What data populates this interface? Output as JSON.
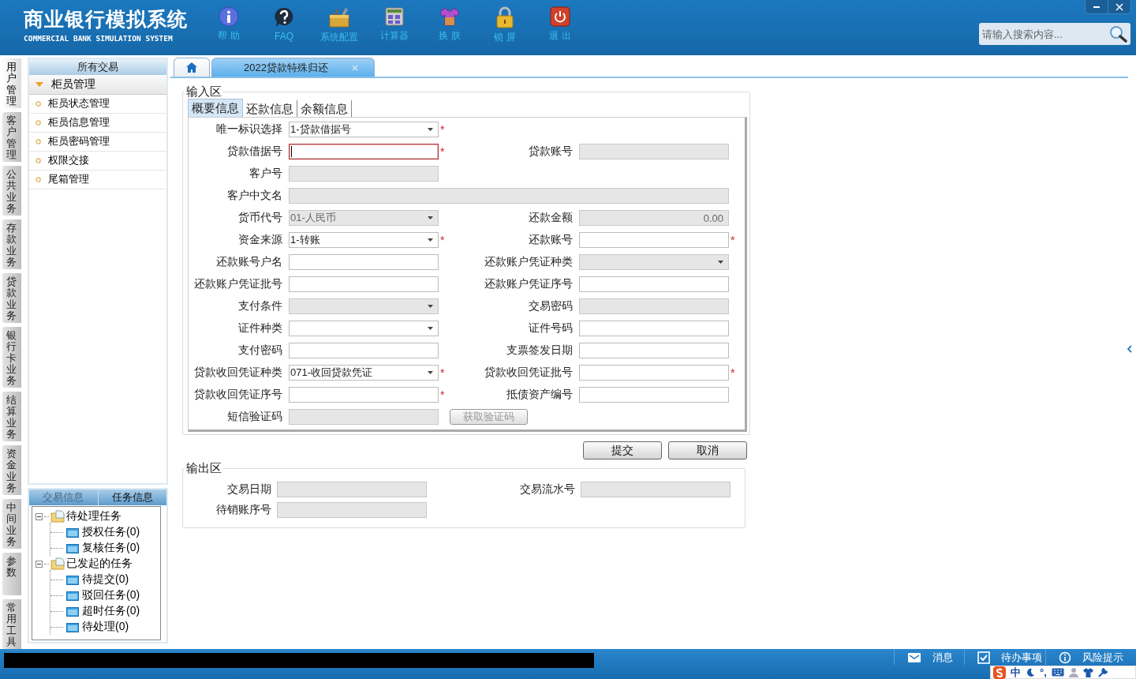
{
  "app": {
    "title": "商业银行模拟系统",
    "subtitle": "COMMERCIAL BANK SIMULATION SYSTEM"
  },
  "toolbar": [
    {
      "kind": "info",
      "label": "帮 助"
    },
    {
      "kind": "faq",
      "label": "FAQ"
    },
    {
      "kind": "config",
      "label": "系统配置"
    },
    {
      "kind": "calculator",
      "label": "计算器"
    },
    {
      "kind": "skin",
      "label": "换 肤"
    },
    {
      "kind": "lock",
      "label": "锁 屏"
    },
    {
      "kind": "exit",
      "label": "退 出"
    }
  ],
  "search": {
    "placeholder": "请输入搜索内容..."
  },
  "module_tabs": [
    {
      "label": "用户管理",
      "selected": true
    },
    {
      "label": "客户管理",
      "selected": false
    },
    {
      "label": "公共业务",
      "selected": false
    },
    {
      "label": "存款业务",
      "selected": false
    },
    {
      "label": "贷款业务",
      "selected": false
    },
    {
      "label": "银行卡业务",
      "selected": false
    },
    {
      "label": "结算业务",
      "selected": false
    },
    {
      "label": "资金业务",
      "selected": false
    },
    {
      "label": "中间业务",
      "selected": false
    },
    {
      "label": "参数",
      "selected": false
    },
    {
      "label": "常用工具",
      "selected": false
    }
  ],
  "nav": {
    "title": "所有交易",
    "groups": [
      {
        "label": "柜员管理",
        "expanded": true,
        "items": [
          "柜员状态管理",
          "柜员信息管理",
          "柜员密码管理",
          "权限交接",
          "尾箱管理"
        ]
      }
    ]
  },
  "task_panel": {
    "tabs": [
      {
        "label": "交易信息",
        "selected": false
      },
      {
        "label": "任务信息",
        "selected": true
      }
    ],
    "tree": [
      {
        "label": "待处理任务",
        "expanded": true,
        "children": [
          {
            "label": "授权任务(0)"
          },
          {
            "label": "复核任务(0)"
          }
        ]
      },
      {
        "label": "已发起的任务",
        "expanded": true,
        "children": [
          {
            "label": "待提交(0)"
          },
          {
            "label": "驳回任务(0)"
          },
          {
            "label": "超时任务(0)"
          },
          {
            "label": "待处理(0)"
          }
        ]
      }
    ]
  },
  "page_tabs": [
    {
      "kind": "home",
      "selected": false,
      "closable": false
    },
    {
      "kind": "page",
      "label": "2022贷款特殊归还",
      "selected": true,
      "closable": true
    }
  ],
  "input_area": {
    "legend": "输入区",
    "required_mark": "*",
    "tabs": [
      {
        "label": "概要信息",
        "selected": true
      },
      {
        "label": "还款信息",
        "selected": false
      },
      {
        "label": "余额信息",
        "selected": false
      }
    ],
    "rows": [
      {
        "left": {
          "label": "唯一标识选择",
          "kind": "select",
          "value": "1-贷款借据号",
          "disabled": false,
          "required": true,
          "invalid": false,
          "wide": false
        }
      },
      {
        "left": {
          "label": "贷款借据号",
          "kind": "text",
          "disabled": false,
          "required": true,
          "invalid": true,
          "wide": false
        },
        "right": {
          "label": "贷款账号",
          "kind": "text",
          "disabled": true,
          "required": false,
          "invalid": false,
          "wide": false
        }
      },
      {
        "left": {
          "label": "客户号",
          "kind": "text",
          "disabled": true,
          "required": false,
          "invalid": false,
          "wide": false
        }
      },
      {
        "left": {
          "label": "客户中文名",
          "kind": "text",
          "disabled": true,
          "required": false,
          "invalid": false,
          "wide": true
        }
      },
      {
        "left": {
          "label": "货币代号",
          "kind": "select",
          "value": "01-人民币",
          "disabled": true,
          "required": false,
          "invalid": false,
          "wide": false
        },
        "right": {
          "label": "还款金额",
          "kind": "amount",
          "value": "0.00",
          "disabled": true,
          "required": false,
          "invalid": false,
          "wide": false
        }
      },
      {
        "left": {
          "label": "资金来源",
          "kind": "select",
          "value": "1-转账",
          "disabled": false,
          "required": true,
          "invalid": false,
          "wide": false
        },
        "right": {
          "label": "还款账号",
          "kind": "text",
          "disabled": false,
          "required": true,
          "invalid": false,
          "wide": false
        }
      },
      {
        "left": {
          "label": "还款账号户名",
          "kind": "text",
          "disabled": false,
          "required": false,
          "invalid": false,
          "wide": false
        },
        "right": {
          "label": "还款账户凭证种类",
          "kind": "select",
          "disabled": true,
          "required": false,
          "invalid": false,
          "wide": false
        }
      },
      {
        "left": {
          "label": "还款账户凭证批号",
          "kind": "text",
          "disabled": false,
          "required": false,
          "invalid": false,
          "wide": false
        },
        "right": {
          "label": "还款账户凭证序号",
          "kind": "text",
          "disabled": false,
          "required": false,
          "invalid": false,
          "wide": false
        }
      },
      {
        "left": {
          "label": "支付条件",
          "kind": "select",
          "disabled": true,
          "required": false,
          "invalid": false,
          "wide": false
        },
        "right": {
          "label": "交易密码",
          "kind": "text",
          "disabled": true,
          "required": false,
          "invalid": false,
          "wide": false
        }
      },
      {
        "left": {
          "label": "证件种类",
          "kind": "select",
          "disabled": false,
          "required": false,
          "invalid": false,
          "wide": false
        },
        "right": {
          "label": "证件号码",
          "kind": "text",
          "disabled": false,
          "required": false,
          "invalid": false,
          "wide": false
        }
      },
      {
        "left": {
          "label": "支付密码",
          "kind": "text",
          "disabled": false,
          "required": false,
          "invalid": false,
          "wide": false
        },
        "right": {
          "label": "支票签发日期",
          "kind": "text",
          "disabled": false,
          "required": false,
          "invalid": false,
          "wide": false
        }
      },
      {
        "left": {
          "label": "贷款收回凭证种类",
          "kind": "select",
          "value": "071-收回贷款凭证",
          "disabled": false,
          "required": true,
          "invalid": false,
          "wide": false
        },
        "right": {
          "label": "贷款收回凭证批号",
          "kind": "text",
          "disabled": false,
          "required": true,
          "invalid": false,
          "wide": false
        }
      },
      {
        "left": {
          "label": "贷款收回凭证序号",
          "kind": "text",
          "disabled": false,
          "required": true,
          "invalid": false,
          "wide": false
        },
        "right": {
          "label": "抵债资产编号",
          "kind": "text",
          "disabled": false,
          "required": false,
          "invalid": false,
          "wide": false
        }
      },
      {
        "left": {
          "label": "短信验证码",
          "kind": "text",
          "disabled": true,
          "required": false,
          "invalid": false,
          "wide": false
        },
        "right": {
          "label": "获取验证码",
          "kind": "button",
          "disabled": true
        }
      }
    ]
  },
  "actions": [
    {
      "label": "提交"
    },
    {
      "label": "取消"
    }
  ],
  "output_area": {
    "legend": "输出区",
    "rows": [
      {
        "left": {
          "label": "交易日期",
          "disabled": true
        },
        "right": {
          "label": "交易流水号",
          "disabled": true
        }
      },
      {
        "left": {
          "label": "待销账序号",
          "disabled": true
        }
      }
    ]
  },
  "status_bar": [
    {
      "kind": "message",
      "label": "消息"
    },
    {
      "kind": "todo",
      "label": "待办事项"
    },
    {
      "kind": "risk",
      "label": "风险提示"
    }
  ],
  "ime_toolbar": {
    "mode": "中",
    "punctuation": "°,"
  }
}
